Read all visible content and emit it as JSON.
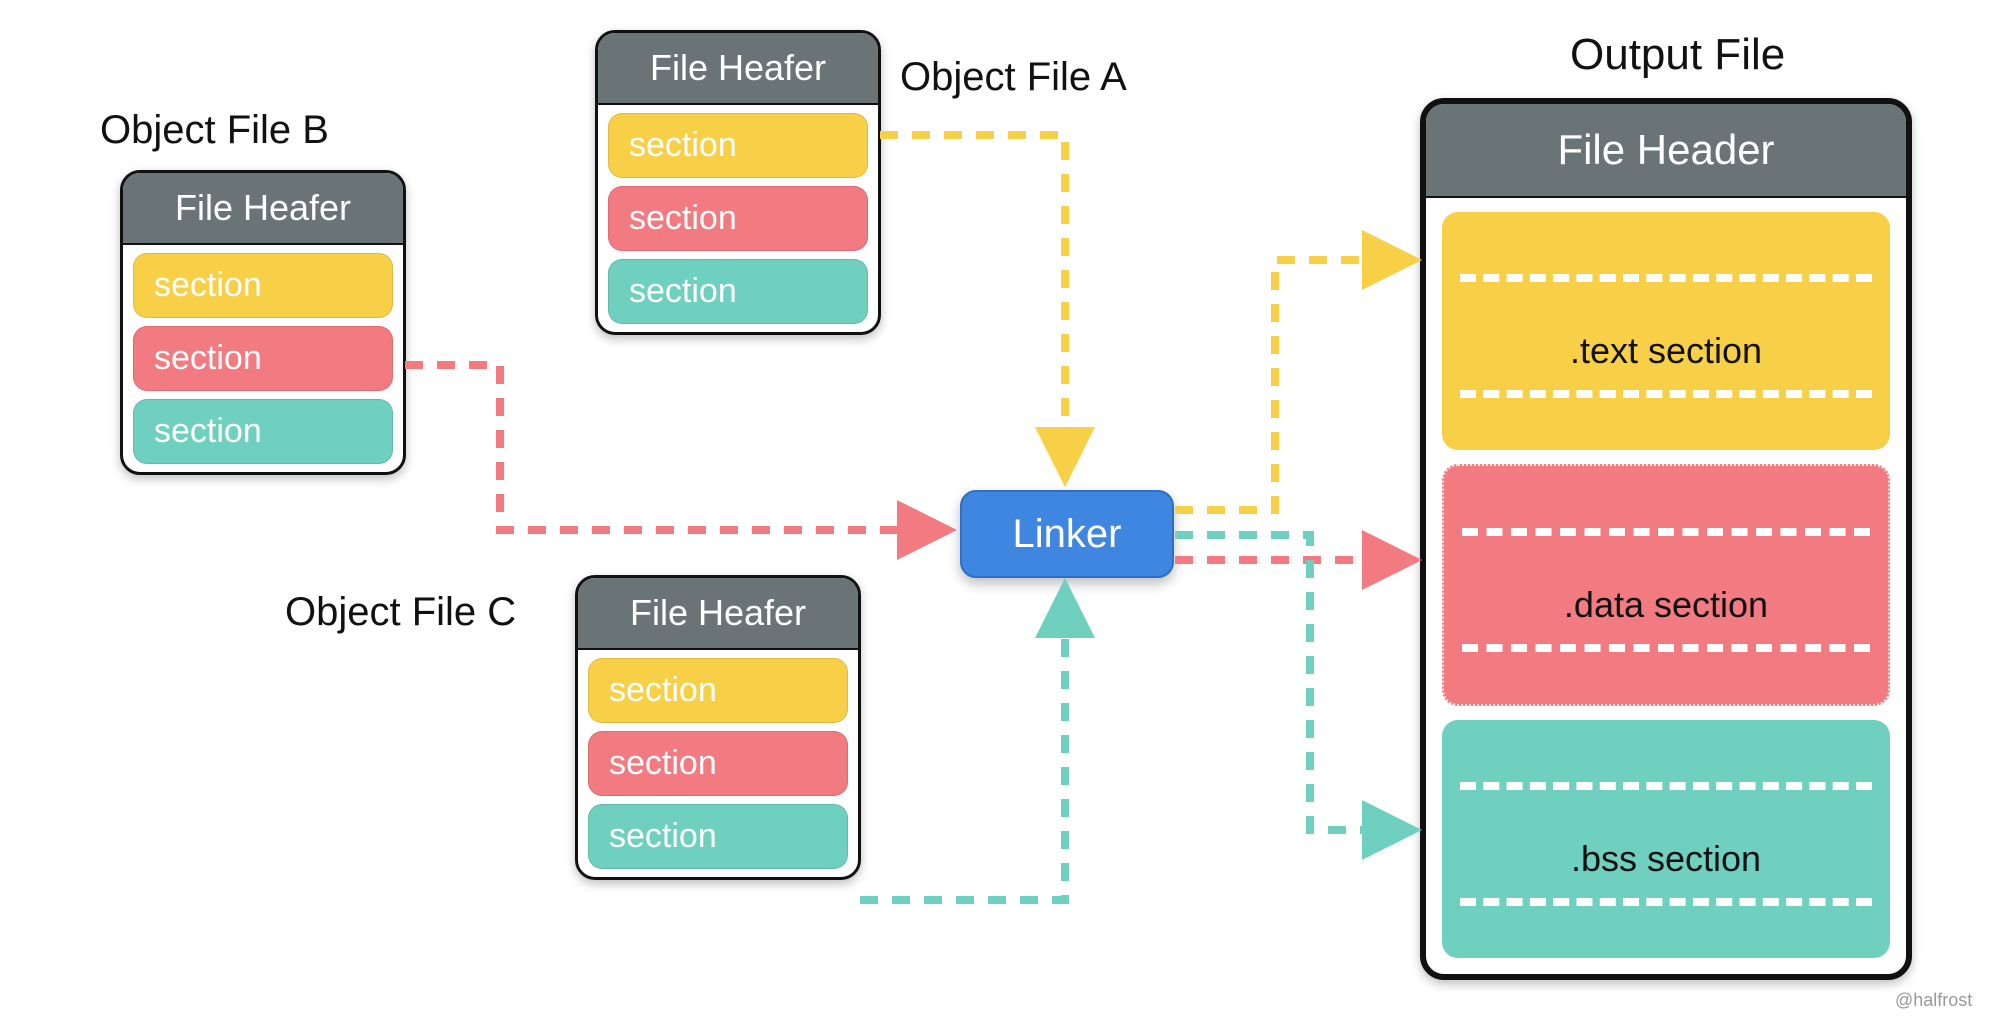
{
  "labels": {
    "fileB": "Object File B",
    "fileA": "Object File A",
    "fileC": "Object File C",
    "output": "Output File"
  },
  "fileA": {
    "header": "File Heafer",
    "sections": [
      "section",
      "section",
      "section"
    ]
  },
  "fileB": {
    "header": "File Heafer",
    "sections": [
      "section",
      "section",
      "section"
    ]
  },
  "fileC": {
    "header": "File Heafer",
    "sections": [
      "section",
      "section",
      "section"
    ]
  },
  "linker": "Linker",
  "output": {
    "header": "File Header",
    "sections": [
      ".text section",
      ".data section",
      ".bss section"
    ]
  },
  "colors": {
    "yellow": "#f7d048",
    "pink": "#f27a81",
    "teal": "#6fd0bf",
    "gray": "#6a7476",
    "blue": "#3f86e0"
  },
  "credit": "@halfrost"
}
